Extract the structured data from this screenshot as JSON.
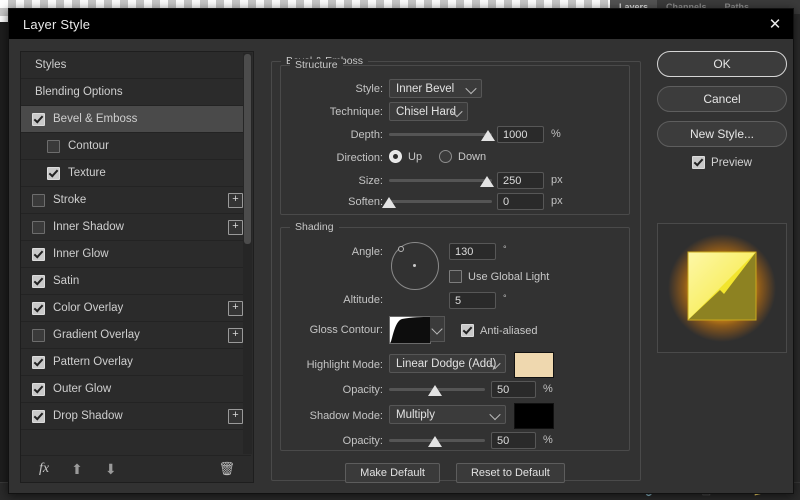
{
  "background": {
    "panel_tabs": [
      {
        "label": "Layers",
        "active": true
      },
      {
        "label": "Channels",
        "active": false
      },
      {
        "label": "Paths",
        "active": false
      }
    ]
  },
  "dialog": {
    "title": "Layer Style",
    "close_icon": "close-icon"
  },
  "styles_list": {
    "items": [
      {
        "label": "Styles",
        "type": "plain",
        "checked": null,
        "selected": false,
        "indent": false,
        "plus": false
      },
      {
        "label": "Blending Options",
        "type": "plain",
        "checked": null,
        "selected": false,
        "indent": false,
        "plus": false
      },
      {
        "label": "Bevel & Emboss",
        "type": "check",
        "checked": true,
        "selected": true,
        "indent": false,
        "plus": false
      },
      {
        "label": "Contour",
        "type": "check",
        "checked": false,
        "selected": false,
        "indent": true,
        "plus": false
      },
      {
        "label": "Texture",
        "type": "check",
        "checked": true,
        "selected": false,
        "indent": true,
        "plus": false
      },
      {
        "label": "Stroke",
        "type": "check",
        "checked": false,
        "selected": false,
        "indent": false,
        "plus": true
      },
      {
        "label": "Inner Shadow",
        "type": "check",
        "checked": false,
        "selected": false,
        "indent": false,
        "plus": true
      },
      {
        "label": "Inner Glow",
        "type": "check",
        "checked": true,
        "selected": false,
        "indent": false,
        "plus": false
      },
      {
        "label": "Satin",
        "type": "check",
        "checked": true,
        "selected": false,
        "indent": false,
        "plus": false
      },
      {
        "label": "Color Overlay",
        "type": "check",
        "checked": true,
        "selected": false,
        "indent": false,
        "plus": true
      },
      {
        "label": "Gradient Overlay",
        "type": "check",
        "checked": false,
        "selected": false,
        "indent": false,
        "plus": true
      },
      {
        "label": "Pattern Overlay",
        "type": "check",
        "checked": true,
        "selected": false,
        "indent": false,
        "plus": false
      },
      {
        "label": "Outer Glow",
        "type": "check",
        "checked": true,
        "selected": false,
        "indent": false,
        "plus": false
      },
      {
        "label": "Drop Shadow",
        "type": "check",
        "checked": true,
        "selected": false,
        "indent": false,
        "plus": true
      }
    ],
    "footer": {
      "fx_label": "fx",
      "up_icon": "arrow-up-icon",
      "down_icon": "arrow-down-icon",
      "trash_icon": "trash-icon"
    }
  },
  "bevel_emboss": {
    "group_label": "Bevel & Emboss",
    "structure": {
      "group_label": "Structure",
      "style_label": "Style:",
      "style_value": "Inner Bevel",
      "technique_label": "Technique:",
      "technique_value": "Chisel Hard",
      "depth_label": "Depth:",
      "depth_value": "1000",
      "depth_unit": "%",
      "depth_percent": 96,
      "direction_label": "Direction:",
      "direction_up": "Up",
      "direction_down": "Down",
      "direction_selected": "Up",
      "size_label": "Size:",
      "size_value": "250",
      "size_unit": "px",
      "size_percent": 95,
      "soften_label": "Soften:",
      "soften_value": "0",
      "soften_unit": "px",
      "soften_percent": 0
    },
    "shading": {
      "group_label": "Shading",
      "angle_label": "Angle:",
      "angle_value": "130",
      "angle_unit": "°",
      "use_global_light_label": "Use Global Light",
      "use_global_light_checked": false,
      "altitude_label": "Altitude:",
      "altitude_value": "5",
      "altitude_unit": "°",
      "gloss_contour_label": "Gloss Contour:",
      "anti_aliased_label": "Anti-aliased",
      "anti_aliased_checked": true,
      "highlight_mode_label": "Highlight Mode:",
      "highlight_mode_value": "Linear Dodge (Add)",
      "highlight_color": "#efd8af",
      "highlight_opacity_label": "Opacity:",
      "highlight_opacity_value": "50",
      "highlight_opacity_unit": "%",
      "highlight_opacity_percent": 48,
      "shadow_mode_label": "Shadow Mode:",
      "shadow_mode_value": "Multiply",
      "shadow_color": "#000000",
      "shadow_opacity_label": "Opacity:",
      "shadow_opacity_value": "50",
      "shadow_opacity_unit": "%",
      "shadow_opacity_percent": 48
    },
    "make_default_label": "Make Default",
    "reset_to_default_label": "Reset to Default"
  },
  "actions": {
    "ok_label": "OK",
    "cancel_label": "Cancel",
    "new_style_label": "New Style...",
    "preview_label": "Preview",
    "preview_checked": true
  },
  "preview_thumb": {
    "glow_color": "#ff9a00",
    "fill_color": "#f7ef55",
    "shadow_color": "#8a8020"
  }
}
